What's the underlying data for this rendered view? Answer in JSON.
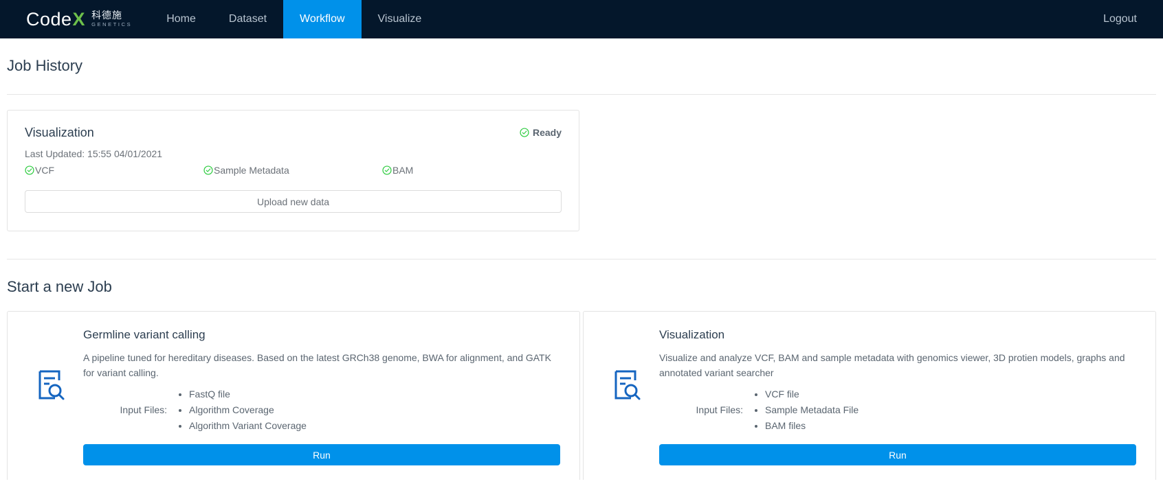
{
  "navbar": {
    "logo": {
      "word_main": "Code",
      "word_x": "X",
      "cn_name": "科德施",
      "cn_sub": "GENETICS"
    },
    "links": [
      {
        "label": "Home",
        "active": false
      },
      {
        "label": "Dataset",
        "active": false
      },
      {
        "label": "Workflow",
        "active": true
      },
      {
        "label": "Visualize",
        "active": false
      }
    ],
    "logout_label": "Logout",
    "bg_color": "#04172b",
    "accent_color": "#0091ea"
  },
  "job_history": {
    "heading": "Job History",
    "card": {
      "title": "Visualization",
      "status": "Ready",
      "status_color": "#2ecc40",
      "last_updated": "Last Updated: 15:55 04/01/2021",
      "files": [
        {
          "label": "VCF",
          "checked": true
        },
        {
          "label": "Sample Metadata",
          "checked": true
        },
        {
          "label": "BAM",
          "checked": true
        }
      ],
      "upload_label": "Upload new data"
    }
  },
  "new_job": {
    "heading": "Start a new Job",
    "input_files_label": "Input Files:",
    "run_label": "Run",
    "cards": [
      {
        "title": "Germline variant calling",
        "description": "A pipeline tuned for hereditary diseases. Based on the latest GRCh38 genome, BWA for alignment, and GATK for variant calling.",
        "inputs": [
          "FastQ file",
          "Algorithm Coverage",
          "Algorithm Variant Coverage"
        ],
        "icon": "document-search-icon"
      },
      {
        "title": "Visualization",
        "description": "Visualize and analyze VCF, BAM and sample metadata with genomics viewer, 3D protien models, graphs and annotated variant searcher",
        "inputs": [
          "VCF file",
          "Sample Metadata File",
          "BAM files"
        ],
        "icon": "document-search-icon"
      }
    ]
  }
}
